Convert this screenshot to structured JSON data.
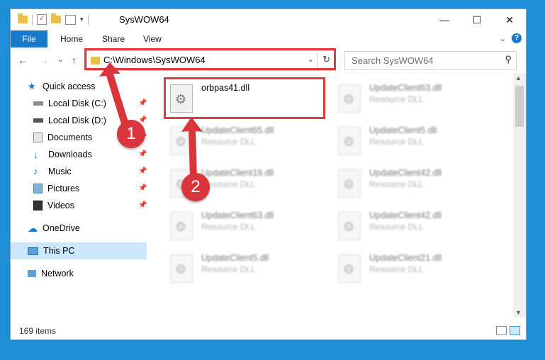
{
  "window": {
    "title": "SysWOW64"
  },
  "caption": {
    "minimize": "—",
    "maximize": "☐",
    "close": "✕"
  },
  "ribbon": {
    "file": "File",
    "tabs": [
      "Home",
      "Share",
      "View"
    ],
    "expand": "⌄",
    "help": "?"
  },
  "nav_buttons": {
    "back": "←",
    "forward": "→",
    "recent": "⌄",
    "up": "↑"
  },
  "address": {
    "path": "C:\\Windows\\SysWOW64",
    "dropdown": "⌄",
    "refresh": "↻"
  },
  "search": {
    "placeholder": "Search SysWOW64"
  },
  "sidebar": {
    "items": [
      {
        "label": "Quick access",
        "icon": "star-icon",
        "pinned": false
      },
      {
        "label": "Local Disk (C:)",
        "icon": "drive-icon",
        "pinned": true
      },
      {
        "label": "Local Disk (D:)",
        "icon": "drive-icon",
        "pinned": true
      },
      {
        "label": "Documents",
        "icon": "documents-icon",
        "pinned": true
      },
      {
        "label": "Downloads",
        "icon": "download-icon",
        "pinned": true
      },
      {
        "label": "Music",
        "icon": "music-icon",
        "pinned": true
      },
      {
        "label": "Pictures",
        "icon": "pictures-icon",
        "pinned": true
      },
      {
        "label": "Videos",
        "icon": "videos-icon",
        "pinned": true
      },
      {
        "label": "OneDrive",
        "icon": "cloud-icon",
        "pinned": false
      },
      {
        "label": "This PC",
        "icon": "computer-icon",
        "pinned": false,
        "selected": true
      },
      {
        "label": "Network",
        "icon": "network-icon",
        "pinned": false
      }
    ]
  },
  "files": [
    {
      "name": "orbpas41.dll",
      "type": "",
      "highlighted": true
    },
    {
      "name": "UpdateClient63.dll",
      "type": "Resource DLL"
    },
    {
      "name": "UpdateClient65.dll",
      "type": "Resource DLL"
    },
    {
      "name": "UpdateClient5.dll",
      "type": "Resource DLL"
    },
    {
      "name": "UpdateClient19.dll",
      "type": "Resource DLL"
    },
    {
      "name": "UpdateClient42.dll",
      "type": "Resource DLL"
    },
    {
      "name": "UpdateClient63.dll",
      "type": "Resource DLL"
    },
    {
      "name": "UpdateClient42.dll",
      "type": "Resource DLL"
    },
    {
      "name": "UpdateClient5.dll",
      "type": "Resource DLL"
    },
    {
      "name": "UpdateClient21.dll",
      "type": "Resource DLL"
    }
  ],
  "status": {
    "item_count": "169 items"
  },
  "annotations": {
    "marker1": "1",
    "marker2": "2",
    "color": "#d9353b"
  }
}
